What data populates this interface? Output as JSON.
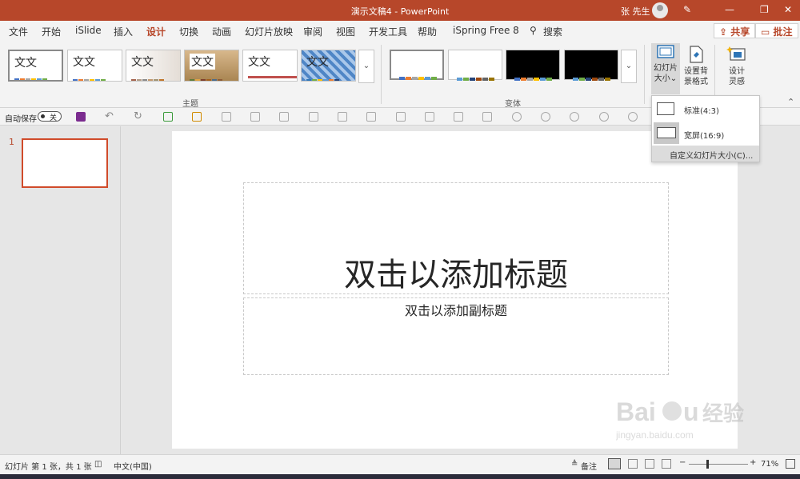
{
  "titlebar": {
    "title": "演示文稿4  -  PowerPoint",
    "user": "张 先生"
  },
  "tabs": [
    "文件",
    "开始",
    "iSlide",
    "插入",
    "设计",
    "切换",
    "动画",
    "幻灯片放映",
    "审阅",
    "视图",
    "开发工具",
    "帮助",
    "iSpring Free 8"
  ],
  "search": {
    "label": "搜索"
  },
  "share": {
    "share_label": "共享",
    "comment_label": "批注"
  },
  "ribbon": {
    "themes_label": "主题",
    "theme_sample_text": "文文",
    "variants_label": "变体",
    "slide_size": {
      "line1": "幻灯片",
      "line2": "大小"
    },
    "format_bg": {
      "line1": "设置背",
      "line2": "景格式"
    },
    "design_ideas": {
      "line1": "设计",
      "line2": "灵感"
    }
  },
  "qat": {
    "autosave_label": "自动保存",
    "autosave_state": "关"
  },
  "dropdown": {
    "items": [
      "标准(4:3)",
      "宽屏(16:9)"
    ],
    "custom": "自定义幻灯片大小(C)..."
  },
  "slides_pane": {
    "thumb_number": "1"
  },
  "slide": {
    "title_placeholder": "双击以添加标题",
    "subtitle_placeholder": "双击以添加副标题"
  },
  "statusbar": {
    "slide_info": "幻灯片 第 1 张，共 1 张",
    "language": "中文(中国)",
    "notes": "备注",
    "zoom": "71%"
  },
  "colors": {
    "accent": "#b7472a",
    "ribbon_bg": "#f3f3f3",
    "canvas_bg": "#e6e6e6"
  }
}
